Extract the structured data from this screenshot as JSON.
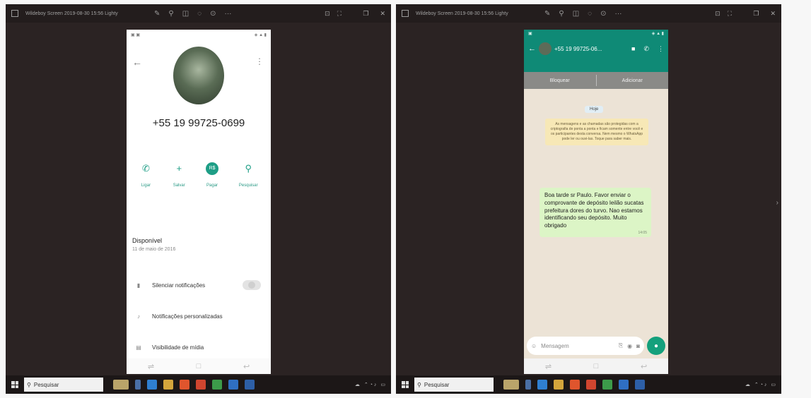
{
  "colors": {
    "accent": "#0f8a76",
    "teal_icon": "#1e9e86",
    "chat_bg": "#ece3d6",
    "bubble": "#dcf5c6"
  },
  "left": {
    "window_title": "Wildeboy Screen 2019-08-30 15:56 Lighty",
    "contact": {
      "phone_number": "+55 19 99725-0699",
      "actions": [
        {
          "label": "Ligar",
          "icon": "phone-icon"
        },
        {
          "label": "Salvar",
          "icon": "add-contact-icon"
        },
        {
          "label": "Pagar",
          "icon": "pay-icon"
        },
        {
          "label": "Pesquisar",
          "icon": "search-icon"
        }
      ],
      "about_title": "Disponível",
      "about_date": "11 de maio de 2016",
      "settings": [
        {
          "label": "Silenciar notificações",
          "icon": "mute-icon"
        },
        {
          "label": "Notificações personalizadas",
          "icon": "music-note-icon"
        },
        {
          "label": "Visibilidade de mídia",
          "icon": "media-icon"
        }
      ]
    }
  },
  "right": {
    "window_title": "Wildeboy Screen 2019-08-30 15:56 Lighty",
    "chat": {
      "contact_name": "+55 19 99725-06...",
      "block_label": "Bloquear",
      "add_label": "Adicionar",
      "date_label": "Hoje",
      "encryption_note": "As mensagens e as chamadas são protegidas com a criptografia de ponta a ponta e ficam somente entre você e os participantes desta conversa. Nem mesmo o WhatsApp pode ler ou ouvi-las. Toque para saber mais.",
      "message_text": "Boa tarde sr Paulo. Favor enviar o comprovante de depósito leilão sucatas prefeitura dores do turvo. Nao estamos identificando seu depósito. Muito obrigado",
      "message_time": "14:05",
      "input_placeholder": "Mensagem"
    }
  },
  "taskbar": {
    "search_label": "Pesquisar"
  }
}
